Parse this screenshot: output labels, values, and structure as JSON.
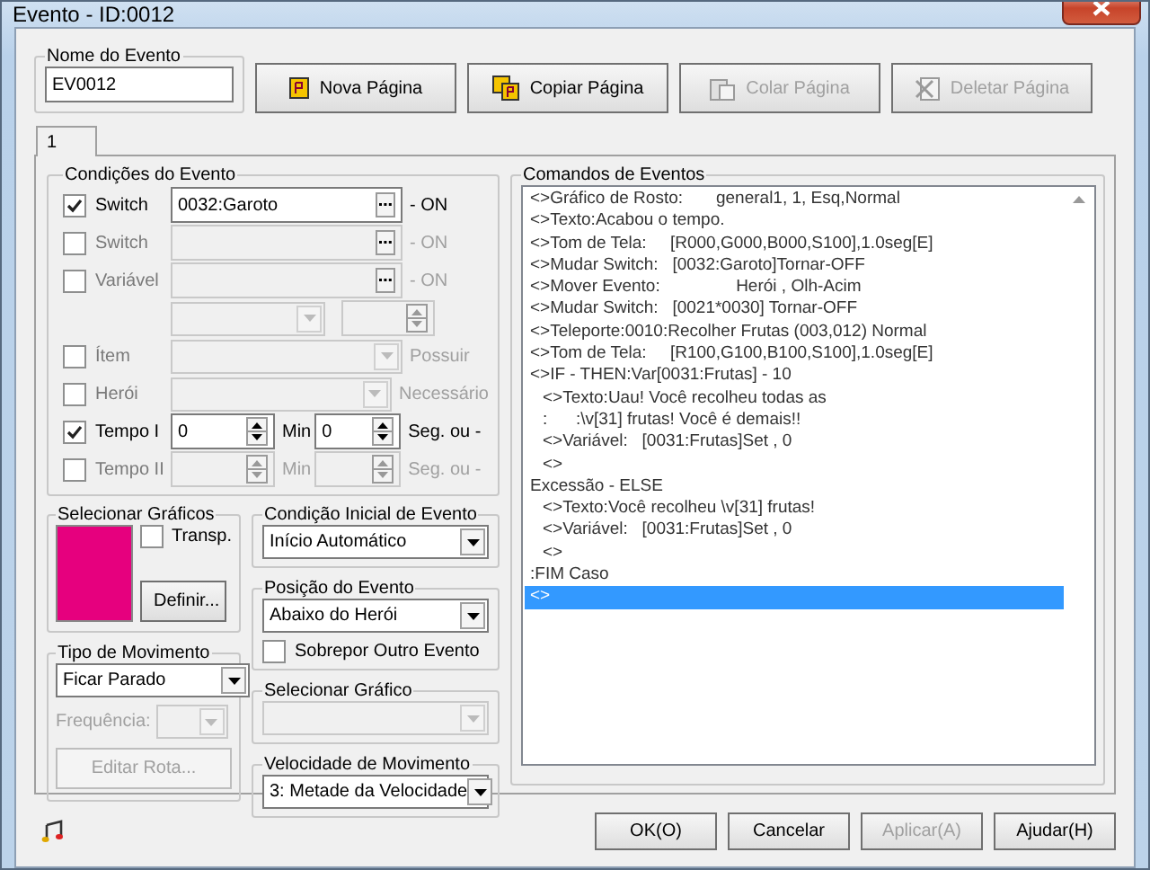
{
  "window": {
    "title": "Evento - ID:0012"
  },
  "event_name": {
    "label": "Nome do Evento",
    "value": "EV0012"
  },
  "page_buttons": [
    {
      "label": "Nova Página",
      "disabled": false,
      "kind": "new"
    },
    {
      "label": "Copiar Página",
      "disabled": false,
      "kind": "copy"
    },
    {
      "label": "Colar Página",
      "disabled": true,
      "kind": "paste"
    },
    {
      "label": "Deletar Página",
      "disabled": true,
      "kind": "delete"
    }
  ],
  "tabs": [
    {
      "label": "1",
      "selected": true
    }
  ],
  "conditions": {
    "title": "Condições do Evento",
    "rows": [
      {
        "kind": "picker",
        "label": "Switch",
        "checked": true,
        "value": "0032:Garoto",
        "suffix": "- ON"
      },
      {
        "kind": "picker",
        "label": "Switch",
        "checked": false,
        "suffix": "- ON"
      },
      {
        "kind": "picker",
        "label": "Variável",
        "checked": false,
        "suffix": "- ON"
      },
      {
        "kind": "compare",
        "disabled": true
      },
      {
        "kind": "dropdown",
        "label": "Ítem",
        "checked": false,
        "suffix": "Possuir"
      },
      {
        "kind": "dropdown",
        "label": "Herói",
        "checked": false,
        "suffix": "Necessário"
      },
      {
        "kind": "timer",
        "label": "Tempo I",
        "checked": true,
        "minutes": "0",
        "seconds": "0",
        "min_label": "Min",
        "sec_label": "Seg. ou -"
      },
      {
        "kind": "timer",
        "label": "Tempo II",
        "checked": false,
        "min_label": "Min",
        "sec_label": "Seg. ou -"
      }
    ]
  },
  "graphics": {
    "title": "Selecionar Gráficos",
    "transparent": {
      "label": "Transp.",
      "checked": false
    },
    "button": "Definir..."
  },
  "trigger": {
    "title": "Condição Inicial de Evento",
    "value": "Início Automático"
  },
  "position": {
    "title": "Posição do Evento",
    "value": "Abaixo do Herói",
    "overlap": {
      "label": "Sobrepor Outro Evento",
      "checked": false
    }
  },
  "movement": {
    "title": "Tipo de Movimento",
    "value": "Ficar Parado",
    "frequency_label": "Frequência:",
    "route_button": "Editar Rota...",
    "disabled": true
  },
  "select_graphic": {
    "title": "Selecionar Gráfico",
    "disabled": true
  },
  "speed": {
    "title": "Velocidade de Movimento",
    "value": "3: Metade da Velocidade"
  },
  "commands": {
    "title": "Comandos de Eventos",
    "lines": [
      {
        "text": "<>Gráfico de Rosto:       general1, 1, Esq,Normal",
        "selected": false
      },
      {
        "text": "<>Texto:Acabou o tempo.",
        "selected": false
      },
      {
        "text": "<>Tom de Tela:     [R000,G000,B000,S100],1.0seg[E]",
        "selected": false
      },
      {
        "text": "<>Mudar Switch:   [0032:Garoto]Tornar-OFF",
        "selected": false
      },
      {
        "text": "<>Mover Evento:                Herói , Olh-Acim",
        "selected": false
      },
      {
        "text": "<>Mudar Switch:   [0021*0030] Tornar-OFF",
        "selected": false
      },
      {
        "text": "<>Teleporte:0010:Recolher Frutas (003,012) Normal",
        "selected": false
      },
      {
        "text": "<>Tom de Tela:     [R100,G100,B100,S100],1.0seg[E]",
        "selected": false
      },
      {
        "text": "<>IF - THEN:Var[0031:Frutas] - 10",
        "selected": false,
        "children": [
          {
            "text": "<>Texto:Uau! Você recolheu todas as",
            "selected": false
          },
          {
            "text": ":      :\\v[31] frutas! Você é demais!!",
            "selected": false
          },
          {
            "text": "<>Variável:   [0031:Frutas]Set , 0",
            "selected": false
          },
          {
            "text": "<>",
            "selected": false
          }
        ]
      },
      {
        "text": "Excessão - ELSE",
        "selected": false,
        "children": [
          {
            "text": "<>Texto:Você recolheu \\v[31] frutas!",
            "selected": false
          },
          {
            "text": "<>Variável:   [0031:Frutas]Set , 0",
            "selected": false
          },
          {
            "text": "<>",
            "selected": false
          }
        ]
      },
      {
        "text": ":FIM Caso",
        "selected": false
      },
      {
        "text": "<>",
        "selected": true
      }
    ]
  },
  "footer_buttons": [
    {
      "label": "OK(O)",
      "disabled": false
    },
    {
      "label": "Cancelar",
      "disabled": false
    },
    {
      "label": "Aplicar(A)",
      "disabled": true
    },
    {
      "label": "Ajudar(H)",
      "disabled": false
    }
  ]
}
